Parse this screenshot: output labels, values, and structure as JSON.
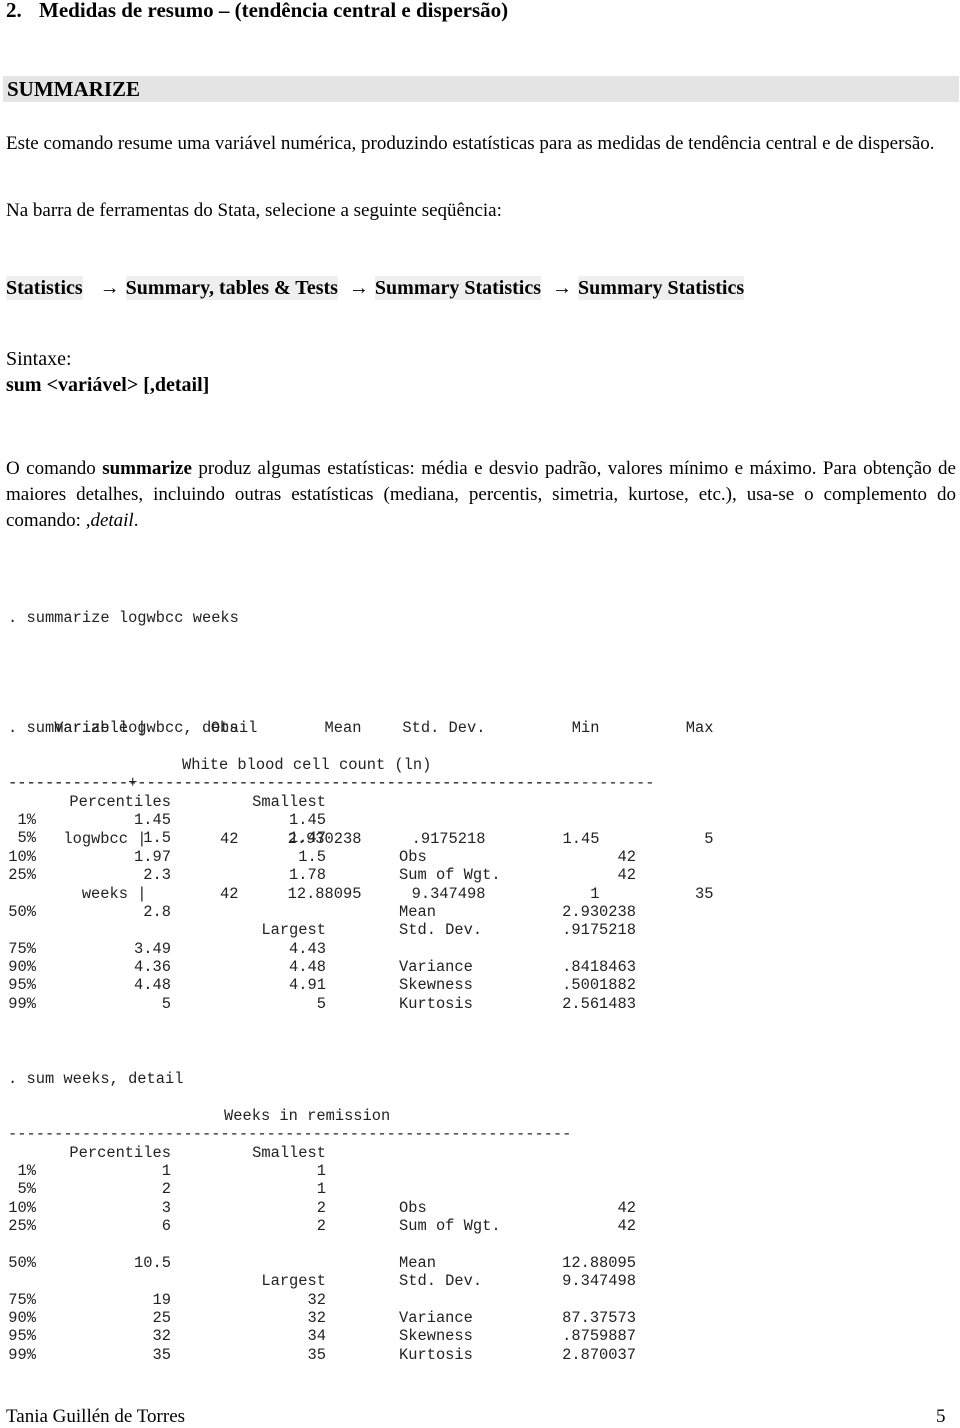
{
  "heading": {
    "number": "2.",
    "title": "Medidas de resumo – (tendência central e dispersão)"
  },
  "section_bar": "SUMMARIZE",
  "intro": "Este comando resume uma variável numérica, produzindo estatísticas para as medidas de tendência central e de dispersão.",
  "menu_instruction": "Na barra de ferramentas do Stata, selecione a seguinte seqüência:",
  "menu_path": [
    "Statistics",
    "Summary, tables & Tests",
    "Summary Statistics",
    "Summary Statistics"
  ],
  "arrow_glyph": "→",
  "syntax": {
    "label": "Sintaxe:",
    "command": "sum <variável> [,detail]"
  },
  "description": {
    "before": "O comando ",
    "bold": "summarize",
    "after": " produz algumas estatísticas: média e desvio padrão, valores mínimo e máximo. Para obtenção de maiores detalhes, incluindo outras estatísticas (mediana, percentis, simetria, kurtose, etc.), usa-se o complemento do comando:  ",
    "italic": ",detail",
    "end": "."
  },
  "summary_output": {
    "command": ". summarize logwbcc weeks",
    "headers": [
      "Variable",
      "Obs",
      "Mean",
      "Std. Dev.",
      "Min",
      "Max"
    ],
    "rows": [
      [
        "logwbcc",
        "42",
        "2.930238",
        ".9175218",
        "1.45",
        "5"
      ],
      [
        "weeks",
        "42",
        "12.88095",
        "9.347498",
        "1",
        "35"
      ]
    ]
  },
  "detail_blocks": [
    {
      "command": ". summarize logwbcc, detail",
      "title": "White blood cell count (ln)",
      "col_percentiles": "Percentiles",
      "col_smallest": "Smallest",
      "col_largest": "Largest",
      "lower": [
        {
          "p": "1%",
          "value": "1.45",
          "extreme": "1.45",
          "stat": "",
          "stat_value": ""
        },
        {
          "p": "5%",
          "value": "1.5",
          "extreme": "1.47",
          "stat": "",
          "stat_value": ""
        },
        {
          "p": "10%",
          "value": "1.97",
          "extreme": "1.5",
          "stat": "Obs",
          "stat_value": "42"
        },
        {
          "p": "25%",
          "value": "2.3",
          "extreme": "1.78",
          "stat": "Sum of Wgt.",
          "stat_value": "42"
        }
      ],
      "median": {
        "p": "50%",
        "value": "2.8",
        "stat": "Mean",
        "stat_value": "2.930238"
      },
      "sd": {
        "stat": "Std. Dev.",
        "stat_value": ".9175218"
      },
      "upper": [
        {
          "p": "75%",
          "value": "3.49",
          "extreme": "4.43",
          "stat": "",
          "stat_value": ""
        },
        {
          "p": "90%",
          "value": "4.36",
          "extreme": "4.48",
          "stat": "Variance",
          "stat_value": ".8418463"
        },
        {
          "p": "95%",
          "value": "4.48",
          "extreme": "4.91",
          "stat": "Skewness",
          "stat_value": ".5001882"
        },
        {
          "p": "99%",
          "value": "5",
          "extreme": "5",
          "stat": "Kurtosis",
          "stat_value": "2.561483"
        }
      ]
    },
    {
      "command": ". sum weeks, detail",
      "title": "Weeks in remission",
      "col_percentiles": "Percentiles",
      "col_smallest": "Smallest",
      "col_largest": "Largest",
      "lower": [
        {
          "p": "1%",
          "value": "1",
          "extreme": "1",
          "stat": "",
          "stat_value": ""
        },
        {
          "p": "5%",
          "value": "2",
          "extreme": "1",
          "stat": "",
          "stat_value": ""
        },
        {
          "p": "10%",
          "value": "3",
          "extreme": "2",
          "stat": "Obs",
          "stat_value": "42"
        },
        {
          "p": "25%",
          "value": "6",
          "extreme": "2",
          "stat": "Sum of Wgt.",
          "stat_value": "42"
        }
      ],
      "median": {
        "p": "50%",
        "value": "10.5",
        "stat": "Mean",
        "stat_value": "12.88095"
      },
      "sd": {
        "stat": "Std. Dev.",
        "stat_value": "9.347498"
      },
      "upper": [
        {
          "p": "75%",
          "value": "19",
          "extreme": "32",
          "stat": "",
          "stat_value": ""
        },
        {
          "p": "90%",
          "value": "25",
          "extreme": "32",
          "stat": "Variance",
          "stat_value": "87.37573"
        },
        {
          "p": "95%",
          "value": "32",
          "extreme": "34",
          "stat": "Skewness",
          "stat_value": ".8759887"
        },
        {
          "p": "99%",
          "value": "35",
          "extreme": "35",
          "stat": "Kurtosis",
          "stat_value": "2.870037"
        }
      ]
    }
  ],
  "footer": {
    "author": "Tania Guillén de Torres",
    "page": "5"
  }
}
